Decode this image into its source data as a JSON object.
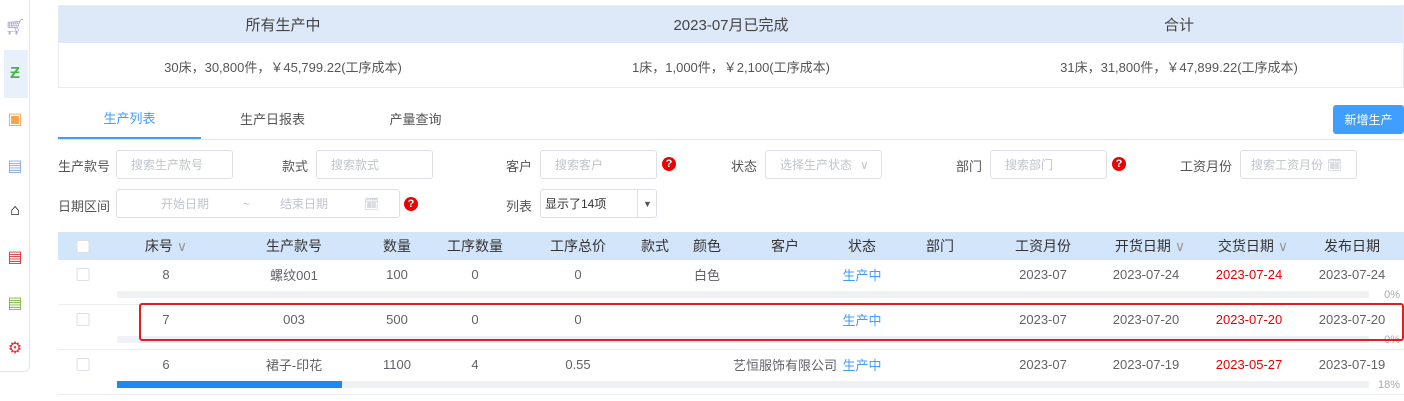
{
  "summary": {
    "headers": [
      "所有生产中",
      "2023-07月已完成",
      "合计"
    ],
    "values": [
      "30床，30,800件，￥45,799.22(工序成本)",
      "1床，1,000件，￥2,100(工序成本)",
      "31床，31,800件，￥47,899.22(工序成本)"
    ]
  },
  "tabs": [
    "生产列表",
    "生产日报表",
    "产量查询"
  ],
  "new_button": "新增生产",
  "filters": {
    "style_no_label": "生产款号",
    "style_no_ph": "搜索生产款号",
    "style_label": "款式",
    "style_ph": "搜索款式",
    "customer_label": "客户",
    "customer_ph": "搜索客户",
    "status_label": "状态",
    "status_ph": "选择生产状态",
    "dept_label": "部门",
    "dept_ph": "搜索部门",
    "wage_label": "工资月份",
    "wage_ph": "搜索工资月份",
    "date_label": "日期区间",
    "start_ph": "开始日期",
    "sep": "~",
    "end_ph": "结束日期",
    "list_label": "列表",
    "list_value": "显示了14项",
    "help": "?"
  },
  "columns": [
    "床号",
    "生产款号",
    "数量",
    "工序数量",
    "工序总价",
    "款式",
    "颜色",
    "客户",
    "状态",
    "部门",
    "工资月份",
    "开货日期",
    "交货日期",
    "发布日期"
  ],
  "rows": [
    {
      "bed": "8",
      "style_no": "螺纹001",
      "qty": "100",
      "proc_qty": "0",
      "proc_total": "0",
      "style": "",
      "color": "白色",
      "customer": "",
      "status": "生产中",
      "dept": "",
      "wage": "2023-07",
      "open": "2023-07-24",
      "delivery": "2023-07-24",
      "publish": "2023-07-24",
      "progress": 0,
      "pct": "0%"
    },
    {
      "bed": "7",
      "style_no": "003",
      "qty": "500",
      "proc_qty": "0",
      "proc_total": "0",
      "style": "",
      "color": "",
      "customer": "",
      "status": "生产中",
      "dept": "",
      "wage": "2023-07",
      "open": "2023-07-20",
      "delivery": "2023-07-20",
      "publish": "2023-07-20",
      "progress": 0,
      "pct": "0%"
    },
    {
      "bed": "6",
      "style_no": "裙子-印花",
      "qty": "1100",
      "proc_qty": "4",
      "proc_total": "0.55",
      "style": "",
      "color": "",
      "customer": "艺恒服饰有限公司",
      "status": "生产中",
      "dept": "",
      "wage": "2023-07",
      "open": "2023-07-19",
      "delivery": "2023-05-27",
      "publish": "2023-07-19",
      "progress": 18,
      "pct": "18%"
    }
  ]
}
